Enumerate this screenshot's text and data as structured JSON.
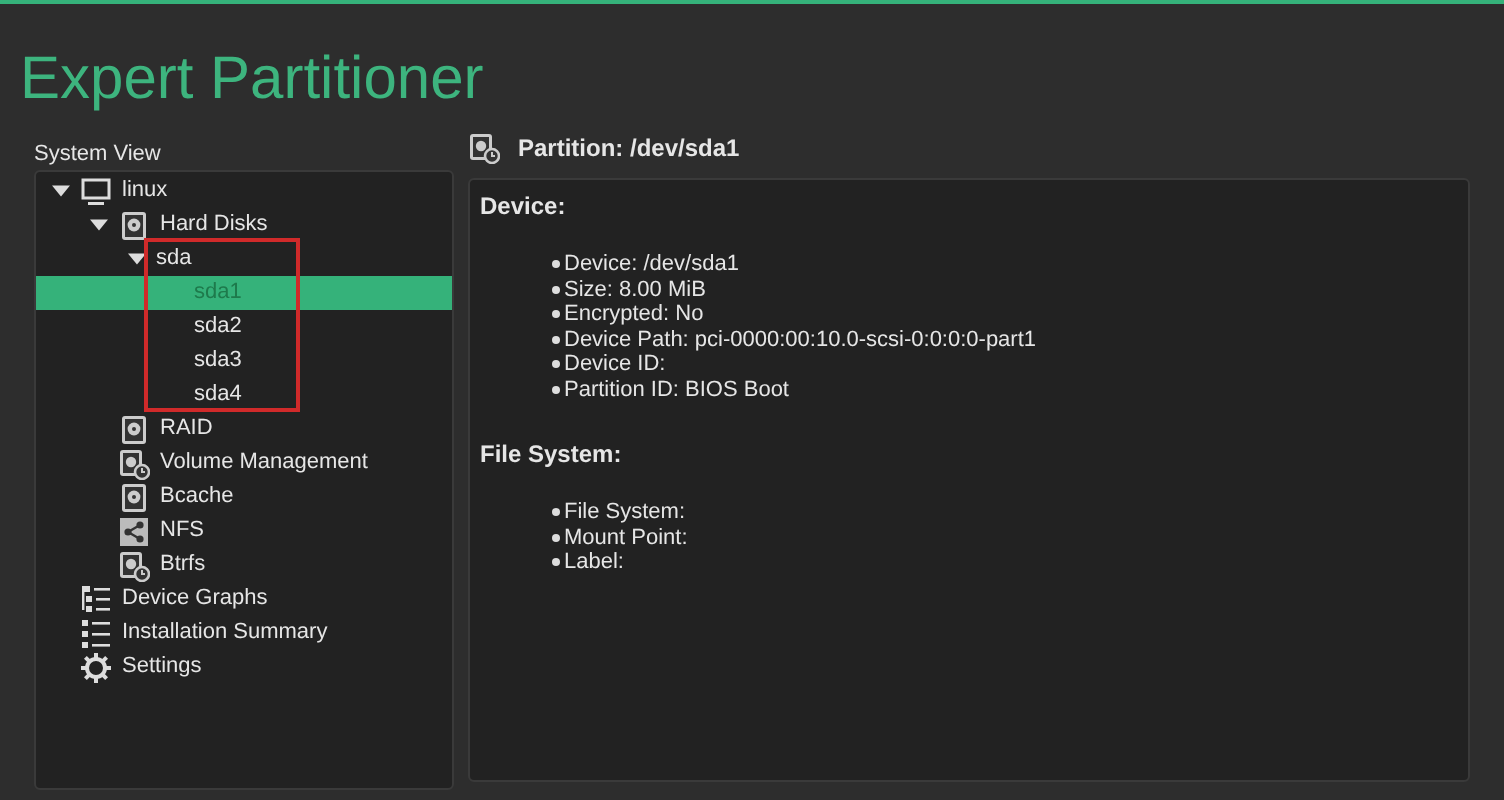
{
  "window": {
    "title": "Expert Partitioner"
  },
  "system_view": {
    "label": "System View",
    "tree": [
      {
        "label": "linux",
        "kind": "computer",
        "expanded": true,
        "selected": false,
        "children": [
          {
            "label": "Hard Disks",
            "kind": "disk",
            "expanded": true,
            "selected": false,
            "children": [
              {
                "label": "sda",
                "expanded": true,
                "selected": false,
                "children": [
                  {
                    "label": "sda1",
                    "selected": true
                  },
                  {
                    "label": "sda2",
                    "selected": false
                  },
                  {
                    "label": "sda3",
                    "selected": false
                  },
                  {
                    "label": "sda4",
                    "selected": false
                  }
                ]
              }
            ]
          },
          {
            "label": "RAID",
            "kind": "disk",
            "selected": false
          },
          {
            "label": "Volume Management",
            "kind": "volume",
            "selected": false
          },
          {
            "label": "Bcache",
            "kind": "disk",
            "selected": false
          },
          {
            "label": "NFS",
            "kind": "share",
            "selected": false
          },
          {
            "label": "Btrfs",
            "kind": "volume",
            "selected": false
          }
        ]
      },
      {
        "label": "Device Graphs",
        "kind": "graph",
        "selected": false
      },
      {
        "label": "Installation Summary",
        "kind": "list",
        "selected": false
      },
      {
        "label": "Settings",
        "kind": "gear",
        "selected": false
      }
    ]
  },
  "details": {
    "title": "Partition: /dev/sda1",
    "sections": [
      {
        "heading": "Device:",
        "items": [
          "Device: /dev/sda1",
          "Size: 8.00 MiB",
          "Encrypted: No",
          "Device Path: pci-0000:00:10.0-scsi-0:0:0:0-part1",
          "Device ID:",
          "Partition ID: BIOS Boot"
        ]
      },
      {
        "heading": "File System:",
        "items": [
          "File System:",
          "Mount Point:",
          "Label:"
        ]
      }
    ]
  }
}
